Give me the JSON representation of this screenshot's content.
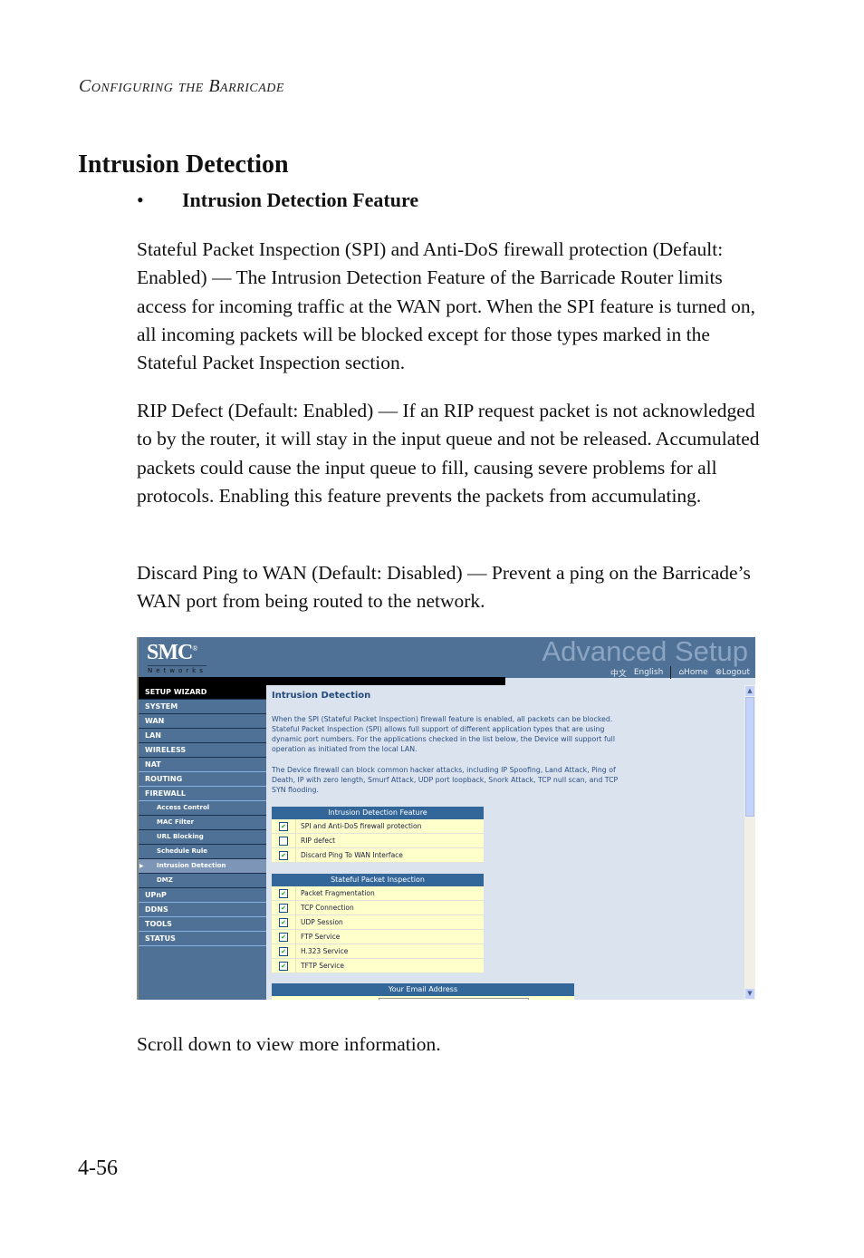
{
  "document": {
    "running_head": "Configuring the Barricade",
    "section_title": "Intrusion Detection",
    "bullet_marker": "•",
    "bullet_heading": "Intrusion Detection Feature",
    "paragraphs": [
      "Stateful Packet Inspection (SPI) and Anti-DoS firewall protection (Default: Enabled) — The Intrusion Detection Feature of the Barricade Router limits access for incoming traffic at the WAN port. When the SPI feature is turned on, all incoming packets will be blocked except for those types marked in the Stateful Packet Inspection section.",
      "RIP Defect (Default: Enabled) — If an RIP request packet is not acknowledged to by the router, it will stay in the input queue and not be released. Accumulated packets could cause the input queue to fill, causing severe problems for all protocols. Enabling this feature prevents the packets from accumulating.",
      "Discard Ping to WAN (Default: Disabled) — Prevent a ping on the Barricade’s WAN port from being routed to the network."
    ],
    "closing_text": "Scroll down to view more information.",
    "page_number": "4-56"
  },
  "screenshot": {
    "logo": "SMC",
    "logo_mark": "®",
    "logo_sub": "Networks",
    "banner_title": "Advanced Setup",
    "header_links": {
      "chinese": "中文",
      "english": "English",
      "home_icon": "⌂",
      "home": "Home",
      "logout_icon": "⊗",
      "logout": "Logout"
    },
    "nav": [
      {
        "label": "SETUP WIZARD",
        "type": "top",
        "first": true
      },
      {
        "label": "SYSTEM",
        "type": "top"
      },
      {
        "label": "WAN",
        "type": "top"
      },
      {
        "label": "LAN",
        "type": "top"
      },
      {
        "label": "WIRELESS",
        "type": "top"
      },
      {
        "label": "NAT",
        "type": "top"
      },
      {
        "label": "ROUTING",
        "type": "top"
      },
      {
        "label": "FIREWALL",
        "type": "top"
      },
      {
        "label": "Access Control",
        "type": "sub"
      },
      {
        "label": "MAC Filter",
        "type": "sub"
      },
      {
        "label": "URL Blocking",
        "type": "sub"
      },
      {
        "label": "Schedule Rule",
        "type": "sub"
      },
      {
        "label": "Intrusion Detection",
        "type": "sub",
        "active": true
      },
      {
        "label": "DMZ",
        "type": "sub"
      },
      {
        "label": "UPnP",
        "type": "top"
      },
      {
        "label": "DDNS",
        "type": "top"
      },
      {
        "label": "TOOLS",
        "type": "top"
      },
      {
        "label": "STATUS",
        "type": "top"
      }
    ],
    "content": {
      "title": "Intrusion Detection",
      "intro1": "When the SPI (Stateful Packet Inspection) firewall feature is enabled, all packets can be blocked.  Stateful Packet Inspection (SPI) allows full support of different application types that are using dynamic port numbers.  For the applications checked in the list below, the Device will support full operation as initiated from the local LAN.",
      "intro2": "The Device firewall can block common hacker attacks, including IP Spoofing, Land Attack, Ping of Death, IP with zero length, Smurf Attack, UDP port loopback, Snork Attack, TCP null scan, and TCP SYN flooding.",
      "feature_table": {
        "header": "Intrusion Detection Feature",
        "rows": [
          {
            "label": "SPI and Anti-DoS firewall protection",
            "checked": true
          },
          {
            "label": "RIP defect",
            "checked": false
          },
          {
            "label": "Discard Ping To WAN Interface",
            "checked": true
          }
        ]
      },
      "spi_table": {
        "header": "Stateful Packet Inspection",
        "rows": [
          {
            "label": "Packet Fragmentation",
            "checked": true
          },
          {
            "label": "TCP Connection",
            "checked": true
          },
          {
            "label": "UDP Session",
            "checked": true
          },
          {
            "label": "FTP Service",
            "checked": true
          },
          {
            "label": "H.323 Service",
            "checked": true
          },
          {
            "label": "TFTP Service",
            "checked": true
          }
        ]
      },
      "email_header": "Your Email Address",
      "email_value": ""
    },
    "scroll": {
      "up": "▲",
      "down": "▼",
      "grip": "="
    },
    "colors": {
      "banner": "#4f7196",
      "table_header": "#336699",
      "row_bg": "#ffffcc",
      "content_bg": "#dbe3ee"
    }
  }
}
